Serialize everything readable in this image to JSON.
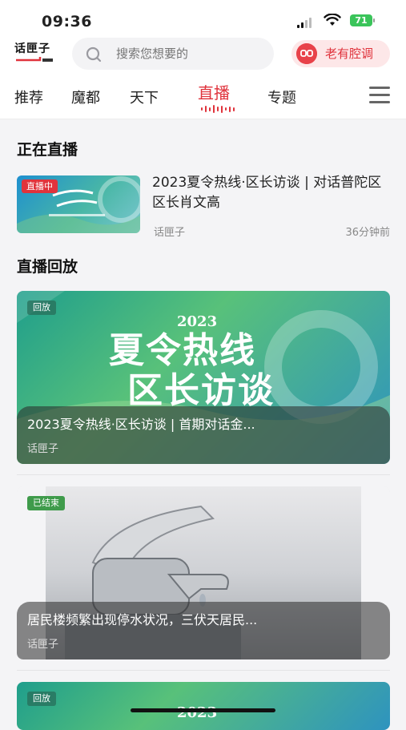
{
  "status": {
    "time": "09:36",
    "battery": "71"
  },
  "header": {
    "logo_text": "话匣子",
    "search_placeholder": "搜索您想要的",
    "dialect_label": "老有腔调"
  },
  "tabs": [
    "推荐",
    "魔都",
    "天下",
    "直播",
    "专题"
  ],
  "active_tab": "直播",
  "live": {
    "section_title": "正在直播",
    "badge": "直播中",
    "title": "2023夏令热线·区长访谈 | 对话普陀区区长肖文高",
    "source": "话匣子",
    "time": "36分钟前"
  },
  "replay": {
    "section_title": "直播回放",
    "items": [
      {
        "badge": "回放",
        "title": "2023夏令热线·区长访谈 | 首期对话金...",
        "source": "话匣子",
        "art_year": "2023",
        "art_line1": "夏令热线",
        "art_line2": "区长访谈"
      },
      {
        "badge": "已结束",
        "title": "居民楼频繁出现停水状况，三伏天居民...",
        "source": "话匣子"
      },
      {
        "badge": "回放",
        "art_year": "2023"
      }
    ]
  },
  "colors": {
    "accent": "#e0333c",
    "live_badge": "#e0333c",
    "ended_badge": "#3f9b4b"
  }
}
